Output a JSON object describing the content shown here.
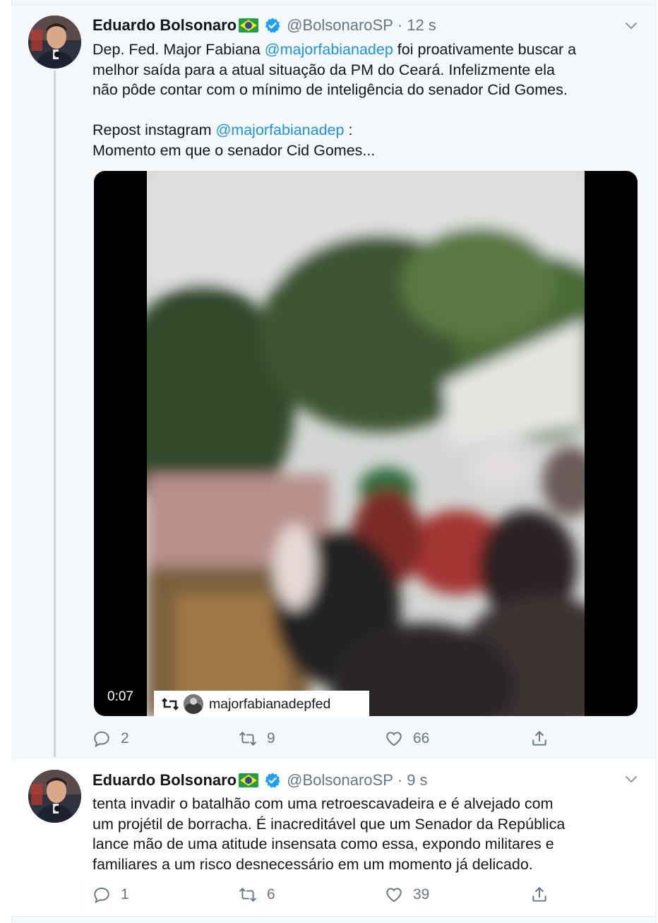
{
  "tweets": [
    {
      "author": {
        "name": "Eduardo Bolsonaro",
        "handle": "@BolsonaroSP",
        "time": "12 s"
      },
      "text": {
        "line1_pre": "Dep. Fed. Major Fabiana ",
        "line1_mention": "@majorfabianadep",
        "line1_post": " foi proativamente buscar a",
        "line2": "melhor saída para a atual situação da PM do Ceará. Infelizmente ela",
        "line3": "não pôde contar com o mínimo de inteligência do senador Cid Gomes.",
        "line5_pre": "Repost instagram ",
        "line5_mention": "@majorfabianadep",
        "line5_post": " :",
        "line6": "Momento em que o senador Cid Gomes..."
      },
      "media": {
        "duration": "0:07",
        "watermark": "majorfabianadepfed"
      },
      "stats": {
        "replies": "2",
        "retweets": "9",
        "likes": "66"
      }
    },
    {
      "author": {
        "name": "Eduardo Bolsonaro",
        "handle": "@BolsonaroSP",
        "time": "9 s"
      },
      "text": {
        "line1": "tenta invadir o batalhão com uma retroescavadeira e é alvejado com",
        "line2": "um projétil de borracha. É inacreditável que um Senador da República",
        "line3": "lance mão de uma atitude insensata como essa, expondo militares e",
        "line4": "familiares a um risco desnecessário em um momento já delicado."
      },
      "stats": {
        "replies": "1",
        "retweets": "6",
        "likes": "39"
      }
    }
  ],
  "icons": {
    "reply": "reply-icon",
    "retweet": "retweet-icon",
    "like": "heart-icon",
    "share": "share-icon",
    "verified": "verified-badge-icon",
    "caret": "chevron-down-icon",
    "flag": "brazil-flag-icon"
  },
  "colors": {
    "link": "#1b95e0",
    "secondary_text": "#657786",
    "verified": "#1da1f2",
    "thread_line": "#ccd6dd"
  }
}
